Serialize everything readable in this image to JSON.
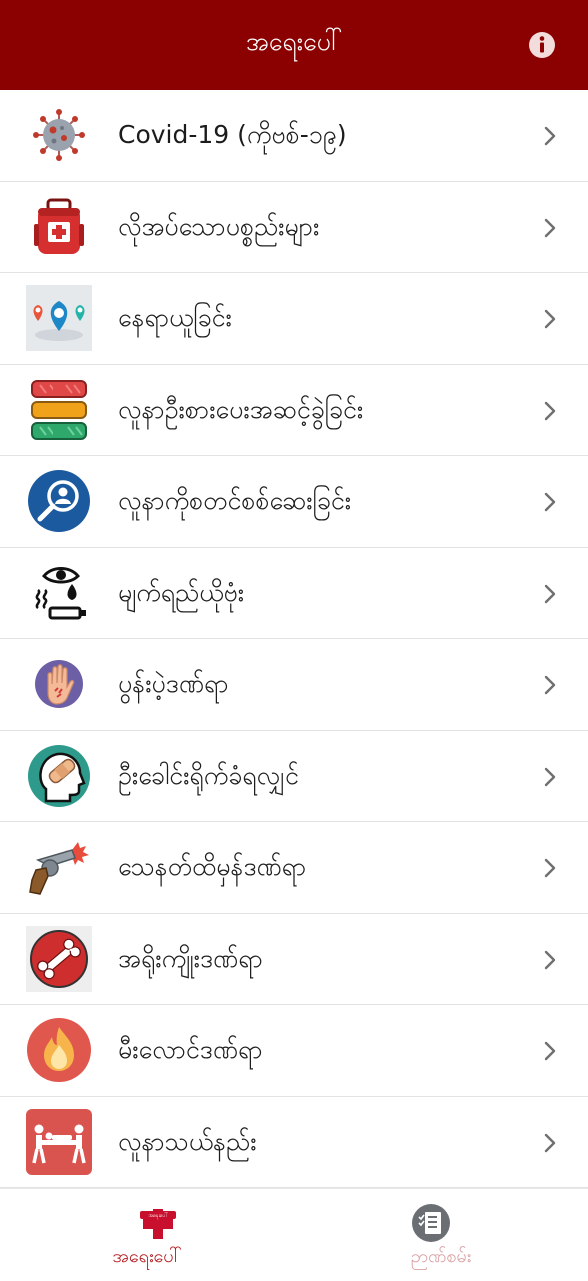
{
  "header": {
    "title": "အရေးပေါ်",
    "info_icon": "info-icon"
  },
  "theme": {
    "primary": "#8b0000",
    "accent": "#b3161c",
    "divider": "#e2e2e2",
    "inactive": "#d9a0a3"
  },
  "menu": [
    {
      "label": "Covid-19 (ကိုဗစ်-၁၉)",
      "icon": "virus-icon"
    },
    {
      "label": "လိုအပ်သောပစ္စည်းများ",
      "icon": "first-aid-bag-icon"
    },
    {
      "label": "နေရာယူခြင်း",
      "icon": "location-pins-icon"
    },
    {
      "label": "လူနာဦးစားပေးအဆင့်ခွဲခြင်း",
      "icon": "triage-levels-icon"
    },
    {
      "label": "လူနာကိုစတင်စစ်ဆေးခြင်း",
      "icon": "patient-search-icon"
    },
    {
      "label": "မျက်ရည်ယိုဗုံး",
      "icon": "tear-gas-icon"
    },
    {
      "label": "ပွန်းပဲ့ဒဏ်ရာ",
      "icon": "hand-wound-icon"
    },
    {
      "label": "ဦးခေါင်းရိုက်ခံရလျှင်",
      "icon": "head-injury-icon"
    },
    {
      "label": "သေနတ်ထိမှန်ဒဏ်ရာ",
      "icon": "gun-icon"
    },
    {
      "label": "အရိုးကျိုးဒဏ်ရာ",
      "icon": "broken-bone-icon"
    },
    {
      "label": "မီးလောင်ဒဏ်ရာ",
      "icon": "fire-icon"
    },
    {
      "label": "လူနာသယ်နည်း",
      "icon": "stretcher-icon"
    }
  ],
  "bottom_nav": [
    {
      "label": "အရေးပေါ်",
      "icon": "medical-cross-icon",
      "active": true,
      "badge": "အရေးပေါ်"
    },
    {
      "label": "ဉာဏ်စမ်း",
      "icon": "quiz-icon",
      "active": false
    }
  ]
}
